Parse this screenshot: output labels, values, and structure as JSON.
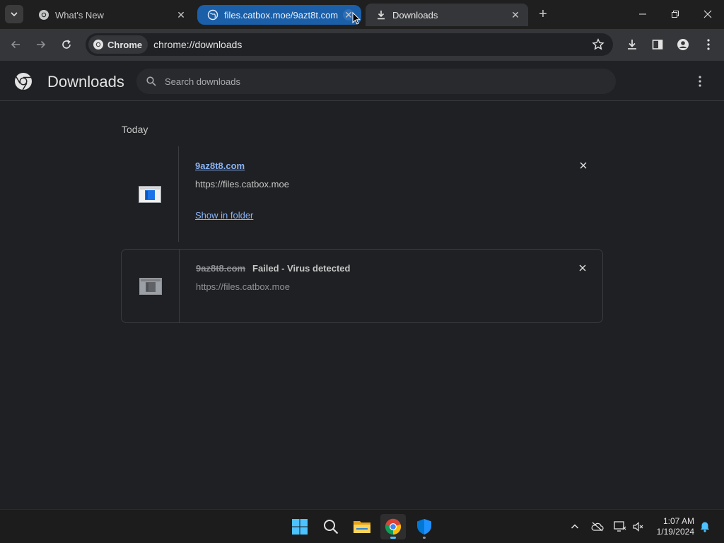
{
  "tabs": [
    {
      "title": "What's New",
      "active": false
    },
    {
      "title": "files.catbox.moe/9azt8t.com",
      "active": false
    },
    {
      "title": "Downloads",
      "active": true
    }
  ],
  "omnibox": {
    "chip_label": "Chrome",
    "url": "chrome://downloads"
  },
  "downloads_page": {
    "title": "Downloads",
    "search_placeholder": "Search downloads",
    "day_label": "Today",
    "items": [
      {
        "filename": "9az8t8.com",
        "source": "https://files.catbox.moe",
        "action_label": "Show in folder",
        "status": ""
      },
      {
        "filename": "9az8t8.com",
        "source": "https://files.catbox.moe",
        "status": "Failed - Virus detected"
      }
    ]
  },
  "taskbar": {
    "time": "1:07 AM",
    "date": "1/19/2024"
  },
  "colors": {
    "accent": "#8ab4f8",
    "active_tab_highlight": "#1a5fa8",
    "background": "#1f2023"
  }
}
